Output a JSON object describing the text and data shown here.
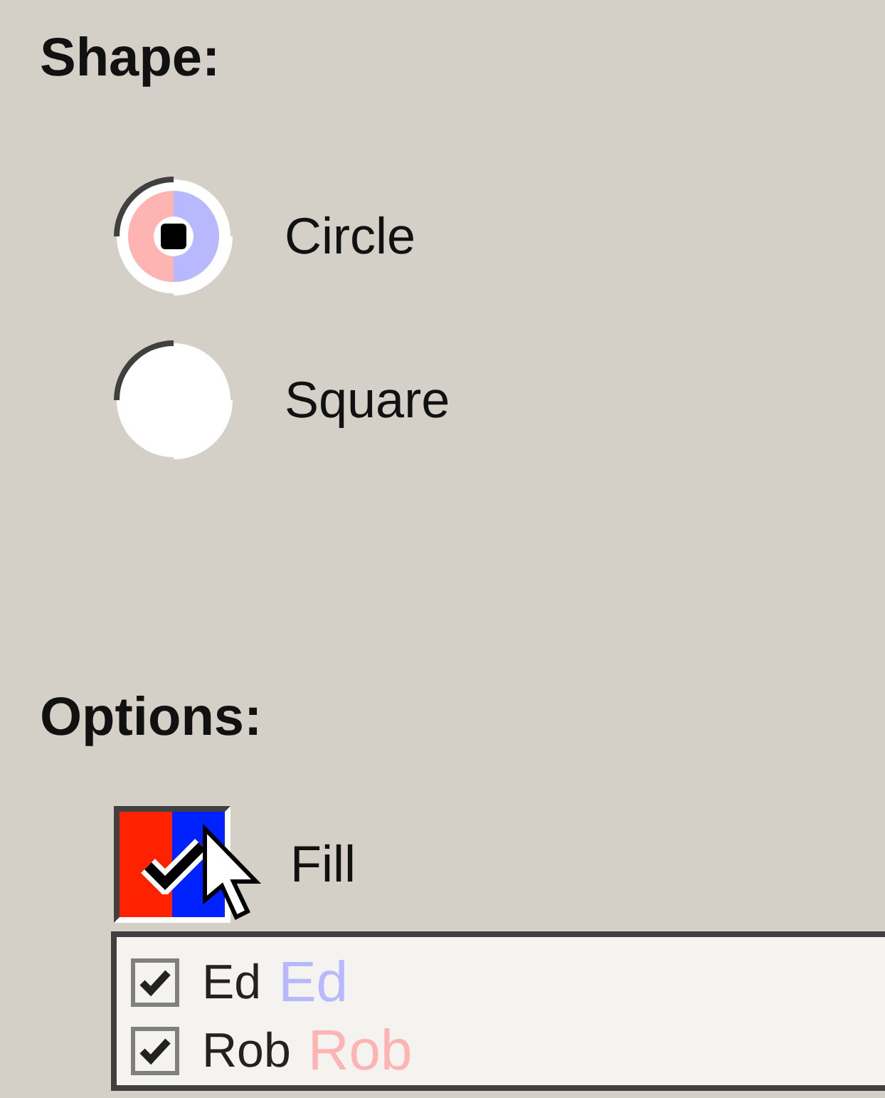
{
  "shape": {
    "heading": "Shape:",
    "options": [
      {
        "label": "Circle",
        "selected": true,
        "highlighted": true
      },
      {
        "label": "Square",
        "selected": false,
        "highlighted": false
      }
    ]
  },
  "options": {
    "heading": "Options:",
    "fill": {
      "label": "Fill",
      "checked": true,
      "highlight_colors": [
        {
          "color": "#ff2200"
        },
        {
          "color": "#0022ff"
        }
      ]
    }
  },
  "users": [
    {
      "name": "Ed",
      "checked": true,
      "color": "#b8b8ff",
      "tag": "Ed"
    },
    {
      "name": "Rob",
      "checked": true,
      "color": "#ffb4b4",
      "tag": "Rob"
    }
  ]
}
